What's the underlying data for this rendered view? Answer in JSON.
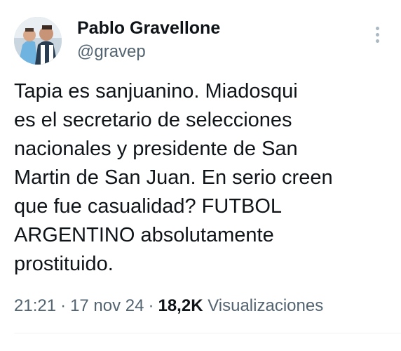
{
  "author": {
    "name": "Pablo Gravellone",
    "handle": "@gravep"
  },
  "tweet": {
    "text": "Tapia es sanjuanino. Miadosqui\nes el secretario de selecciones\nnacionales y presidente de San\nMartin de San Juan. En serio creen\nque fue casualidad? FUTBOL\nARGENTINO absolutamente\nprostituido."
  },
  "meta": {
    "time": "21:21",
    "separator": "·",
    "date": "17 nov 24",
    "views_count": "18,2K",
    "views_label": "Visualizaciones"
  },
  "colors": {
    "text": "#0f1419",
    "secondary": "#536471",
    "divider": "#eff3f4"
  },
  "icons": {
    "more": "more-vertical-icon"
  }
}
